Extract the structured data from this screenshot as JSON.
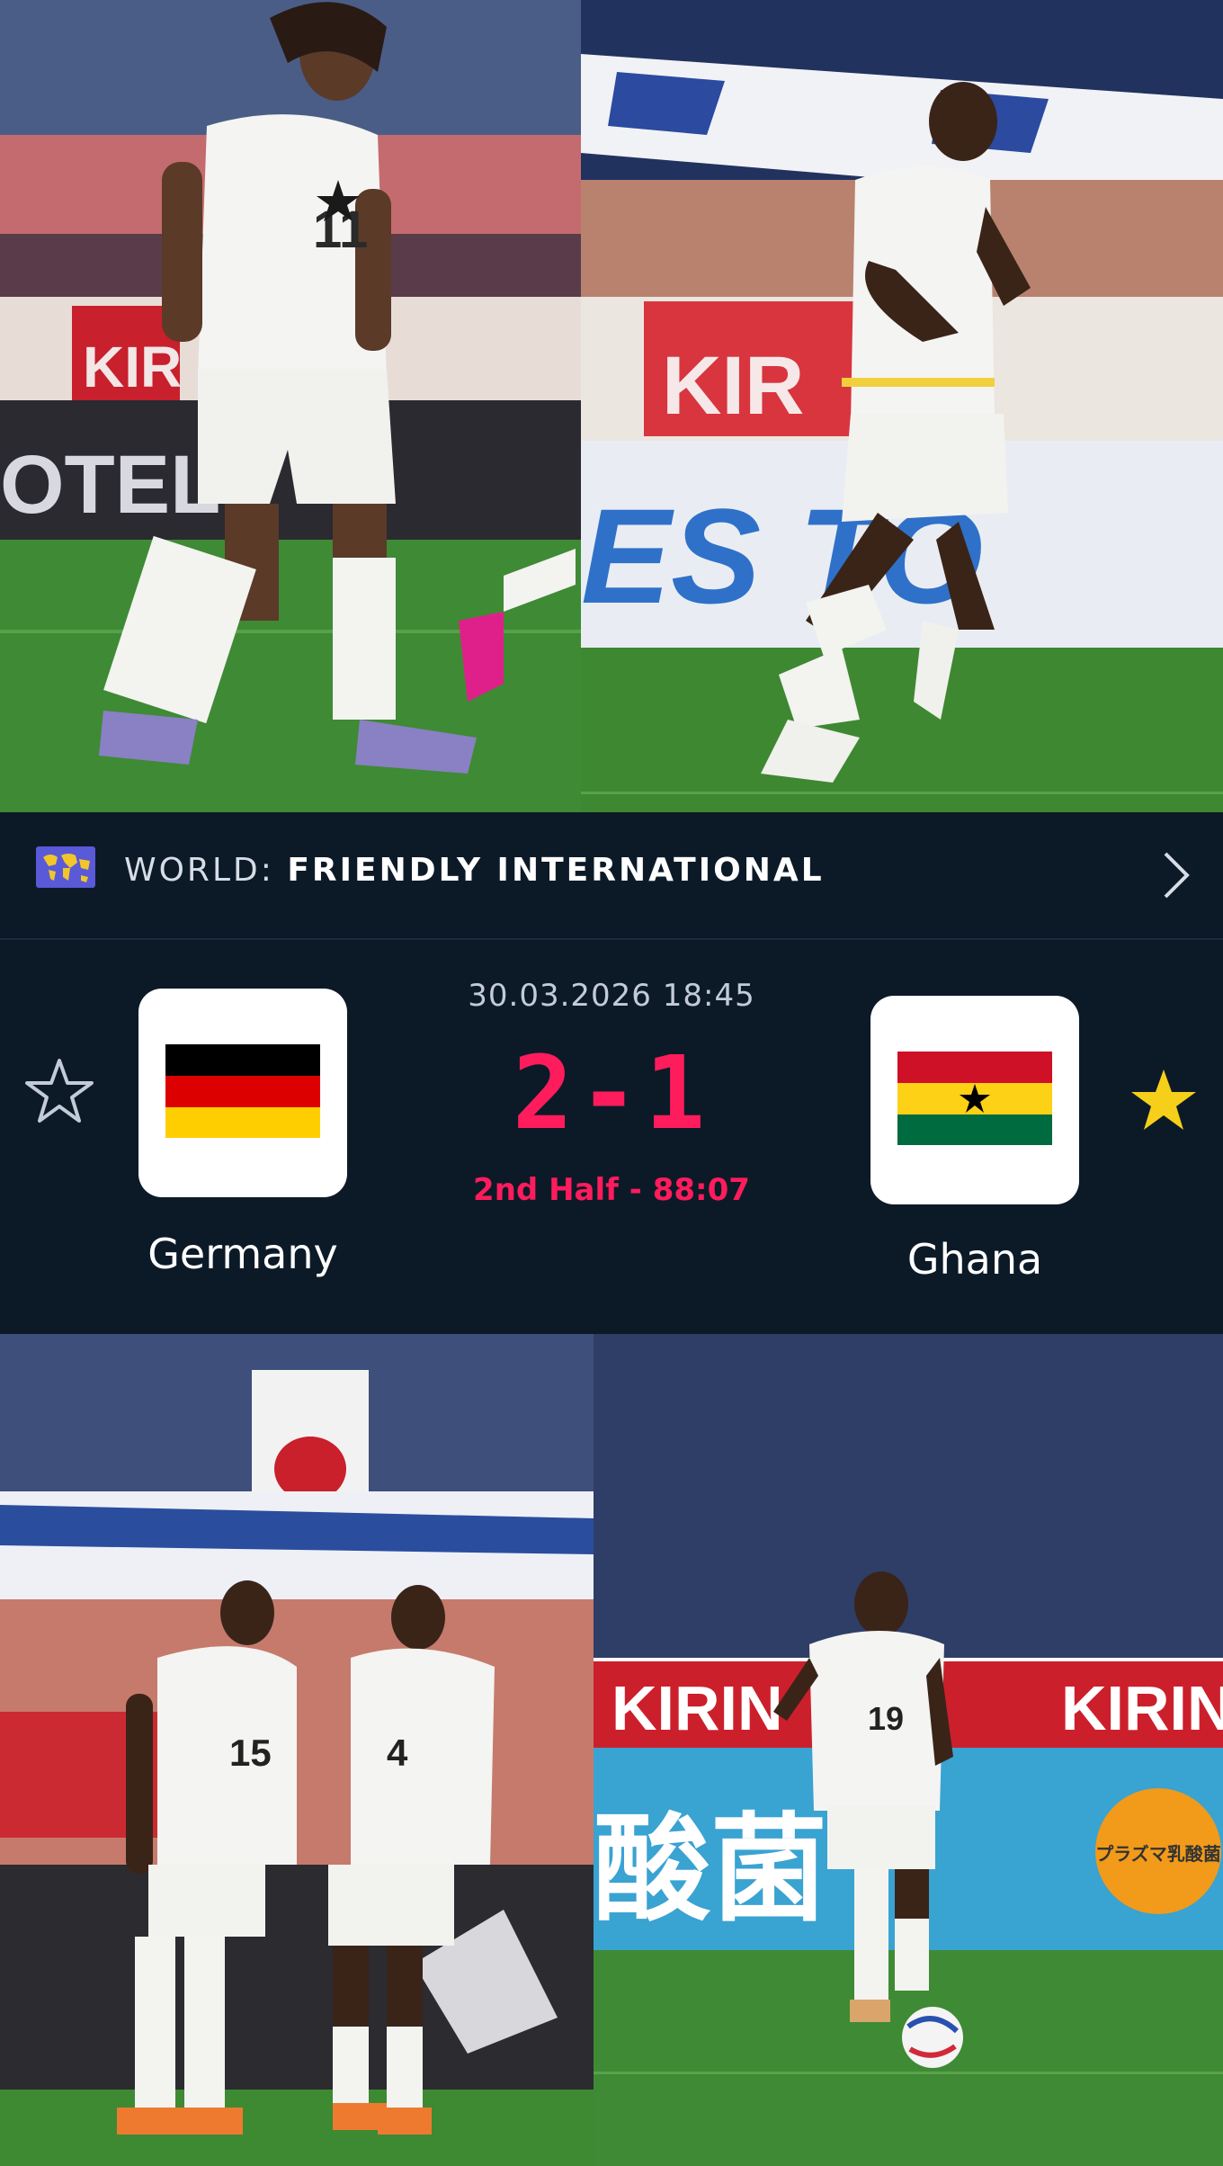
{
  "match": {
    "competition_prefix": "WORLD:",
    "competition_name": "FRIENDLY INTERNATIONAL",
    "date_time": "30.03.2026 18:45",
    "score": "2-1",
    "status": "2nd Half - 88:07",
    "home_team": {
      "name": "Germany",
      "favorite": false
    },
    "away_team": {
      "name": "Ghana",
      "favorite": true
    }
  },
  "photos": {
    "top_left": {
      "jersey_number": "11",
      "banner_text": "OTEL",
      "board_text": "KIR"
    },
    "top_right": {
      "board_text": "KIR",
      "banner_text": "ES TO"
    },
    "bottom_left": {
      "jersey_numbers": [
        "15",
        "4"
      ]
    },
    "bottom_right": {
      "jersey_number": "19",
      "board_text_1": "KIRIN",
      "board_text_2": "KIRIN",
      "banner_text": "酸菌",
      "badge_text": "プラズマ乳酸菌"
    }
  },
  "colors": {
    "background": "#0c1a28",
    "score_accent": "#ff1c5c",
    "favorite_star": "#f6cf1a",
    "kit_white": "#f4f4f2",
    "pitch_green": "#3f8a35"
  },
  "icons": {
    "competition": "globe-map-icon",
    "navigate": "chevron-right-icon",
    "favorite_empty": "star-outline-icon",
    "favorite_filled": "star-filled-icon"
  }
}
